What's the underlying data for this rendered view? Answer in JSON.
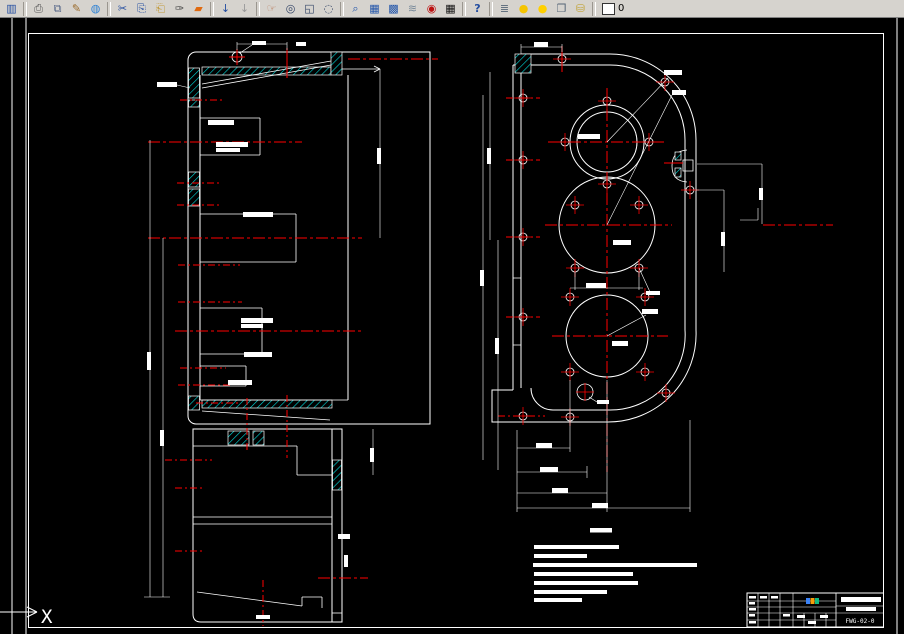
{
  "toolbar": {
    "layer_value": "0",
    "groups": [
      [
        "save"
      ],
      [
        "print",
        "print-preview",
        "plot-stamp",
        "web-publish"
      ],
      [
        "cut",
        "copy",
        "paste",
        "format-brush",
        "property-paint"
      ],
      [
        "undo",
        "redo"
      ],
      [
        "pan",
        "zoom-realtime",
        "zoom-window",
        "zoom-previous"
      ],
      [
        "find",
        "block-manager",
        "block-editor",
        "aerial-view",
        "record-macro",
        "table-grid"
      ],
      [
        "help"
      ],
      [
        "layer-manager",
        "layer-bulb",
        "color-ball",
        "page-setup",
        "database"
      ]
    ]
  },
  "drawing": {
    "ucs_label": "X",
    "views": {
      "left_view": "section-side-view",
      "bottom_view": "bottom-section-view",
      "right_view": "front-view-with-bores"
    },
    "colors": {
      "line": "#ffffff",
      "centerline": "#ff0000",
      "hatch": "#00e0e0",
      "background": "#000000"
    },
    "title_block": {
      "drawing_number": "FWG-02-0"
    }
  }
}
